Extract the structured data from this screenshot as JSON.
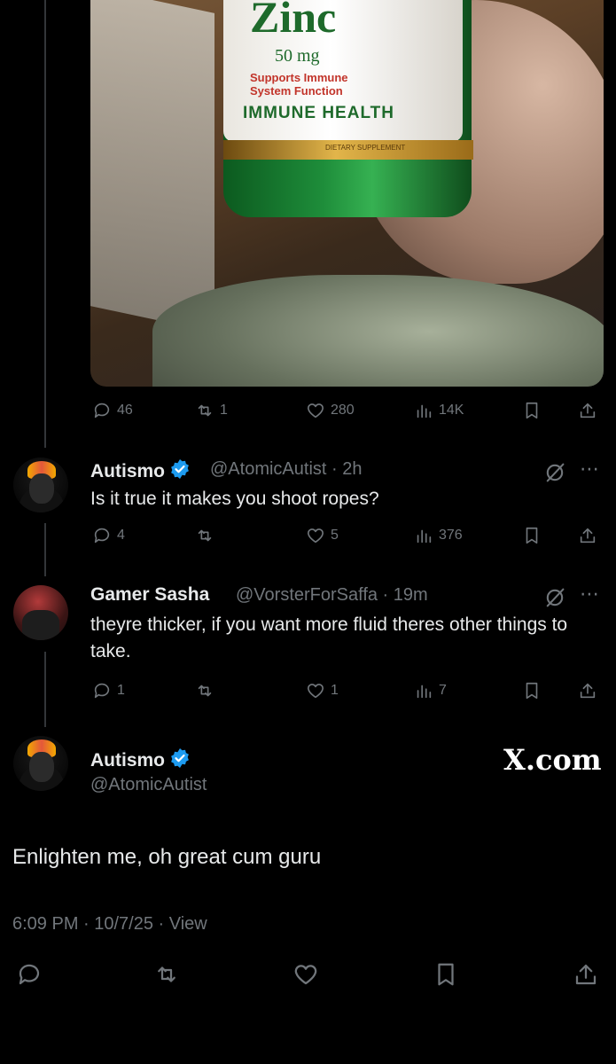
{
  "media": {
    "bottle_brand": "Zinc",
    "bottle_dose": "50 mg",
    "bottle_claim": "Supports Immune System Function",
    "bottle_band": "IMMUNE HEALTH",
    "bottle_small": "DIETARY SUPPLEMENT"
  },
  "tweet0_stats": {
    "replies": "46",
    "reposts": "1",
    "likes": "280",
    "views": "14K"
  },
  "reply1": {
    "name": "Autismo",
    "handle_time": "@AtomicAutist · 2h",
    "text": "Is it true it makes you shoot ropes?",
    "stats": {
      "replies": "4",
      "reposts": "",
      "likes": "5",
      "views": "376"
    }
  },
  "reply2": {
    "name": "Gamer Sasha",
    "handle_time": "@VorsterForSaffa · 19m",
    "text": "theyre thicker, if you want more fluid theres other things to take.",
    "stats": {
      "replies": "1",
      "reposts": "",
      "likes": "1",
      "views": "7"
    }
  },
  "main": {
    "name": "Autismo",
    "handle": "@AtomicAutist",
    "watermark": "X.com",
    "text": "Enlighten me, oh great cum guru",
    "meta": "6:09 PM · 10/7/25 · View"
  },
  "colors": {
    "background": "#000000",
    "muted": "#71767b",
    "verified": "#1d9bf0",
    "text": "#e7e9ea"
  }
}
